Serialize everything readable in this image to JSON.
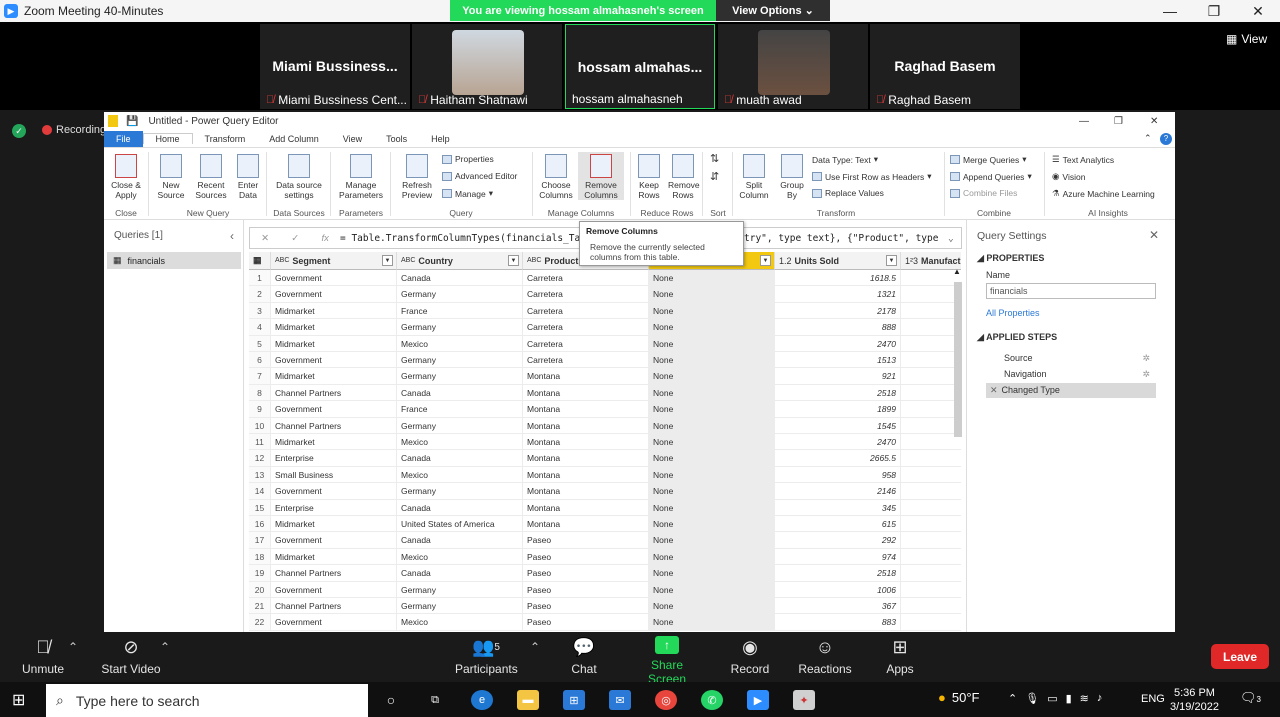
{
  "zoom": {
    "title": "Zoom Meeting 40-Minutes",
    "viewing_banner": "You are viewing hossam almahasneh's screen",
    "view_options": "View Options",
    "view_button": "View",
    "recording": "Recording",
    "participants": [
      {
        "big_name": "Miami  Bussiness...",
        "label": "Miami Bussiness Cent..."
      },
      {
        "big_name": "",
        "label": "Haitham Shatnawi"
      },
      {
        "big_name": "hossam  almahas...",
        "label": "hossam almahasneh"
      },
      {
        "big_name": "",
        "label": "muath awad"
      },
      {
        "big_name": "Raghad Basem",
        "label": "Raghad Basem"
      }
    ],
    "bottom": {
      "unmute": "Unmute",
      "start_video": "Start Video",
      "participants": "Participants",
      "participants_count": "5",
      "chat": "Chat",
      "share_screen": "Share Screen",
      "record": "Record",
      "reactions": "Reactions",
      "apps": "Apps",
      "leave": "Leave"
    }
  },
  "pq": {
    "title": "Untitled - Power Query Editor",
    "menu": [
      "File",
      "Home",
      "Transform",
      "Add Column",
      "View",
      "Tools",
      "Help"
    ],
    "ribbon": {
      "close_apply": "Close &\nApply",
      "new_source": "New\nSource",
      "recent_sources": "Recent\nSources",
      "enter_data": "Enter\nData",
      "data_source_settings": "Data source\nsettings",
      "manage_parameters": "Manage\nParameters",
      "refresh_preview": "Refresh\nPreview",
      "properties": "Properties",
      "advanced_editor": "Advanced Editor",
      "manage": "Manage",
      "choose_columns": "Choose\nColumns",
      "remove_columns": "Remove\nColumns",
      "keep_rows": "Keep\nRows",
      "remove_rows": "Remove\nRows",
      "split_column": "Split\nColumn",
      "group_by": "Group\nBy",
      "data_type": "Data Type: Text",
      "use_first_row": "Use First Row as Headers",
      "replace_values": "Replace Values",
      "merge_queries": "Merge Queries",
      "append_queries": "Append Queries",
      "combine_files": "Combine Files",
      "text_analytics": "Text Analytics",
      "vision": "Vision",
      "azure_ml": "Azure Machine Learning",
      "groups": [
        "Close",
        "New Query",
        "Data Sources",
        "Parameters",
        "Query",
        "Manage Columns",
        "Reduce Rows",
        "Sort",
        "Transform",
        "Combine",
        "AI Insights"
      ]
    },
    "queries_header": "Queries [1]",
    "query_item": "financials",
    "formula_left": "= Table.TransformColumnTypes(financials_Table",
    "formula_right": "try\", type text}, {\"Product\", type",
    "tooltip": {
      "title": "Remove Columns",
      "desc": "Remove the currently selected columns from this table."
    },
    "columns": [
      "Segment",
      "Country",
      "Product",
      "",
      "Units Sold",
      "Manufactur"
    ],
    "column_types": [
      "ABC",
      "ABC",
      "ABC",
      "",
      "1.2",
      "1²3"
    ],
    "rows": [
      [
        "1",
        "Government",
        "Canada",
        "Carretera",
        "None",
        "1618.5"
      ],
      [
        "2",
        "Government",
        "Germany",
        "Carretera",
        "None",
        "1321"
      ],
      [
        "3",
        "Midmarket",
        "France",
        "Carretera",
        "None",
        "2178"
      ],
      [
        "4",
        "Midmarket",
        "Germany",
        "Carretera",
        "None",
        "888"
      ],
      [
        "5",
        "Midmarket",
        "Mexico",
        "Carretera",
        "None",
        "2470"
      ],
      [
        "6",
        "Government",
        "Germany",
        "Carretera",
        "None",
        "1513"
      ],
      [
        "7",
        "Midmarket",
        "Germany",
        "Montana",
        "None",
        "921"
      ],
      [
        "8",
        "Channel Partners",
        "Canada",
        "Montana",
        "None",
        "2518"
      ],
      [
        "9",
        "Government",
        "France",
        "Montana",
        "None",
        "1899"
      ],
      [
        "10",
        "Channel Partners",
        "Germany",
        "Montana",
        "None",
        "1545"
      ],
      [
        "11",
        "Midmarket",
        "Mexico",
        "Montana",
        "None",
        "2470"
      ],
      [
        "12",
        "Enterprise",
        "Canada",
        "Montana",
        "None",
        "2665.5"
      ],
      [
        "13",
        "Small Business",
        "Mexico",
        "Montana",
        "None",
        "958"
      ],
      [
        "14",
        "Government",
        "Germany",
        "Montana",
        "None",
        "2146"
      ],
      [
        "15",
        "Enterprise",
        "Canada",
        "Montana",
        "None",
        "345"
      ],
      [
        "16",
        "Midmarket",
        "United States of America",
        "Montana",
        "None",
        "615"
      ],
      [
        "17",
        "Government",
        "Canada",
        "Paseo",
        "None",
        "292"
      ],
      [
        "18",
        "Midmarket",
        "Mexico",
        "Paseo",
        "None",
        "974"
      ],
      [
        "19",
        "Channel Partners",
        "Canada",
        "Paseo",
        "None",
        "2518"
      ],
      [
        "20",
        "Government",
        "Germany",
        "Paseo",
        "None",
        "1006"
      ],
      [
        "21",
        "Channel Partners",
        "Germany",
        "Paseo",
        "None",
        "367"
      ],
      [
        "22",
        "Government",
        "Mexico",
        "Paseo",
        "None",
        "883"
      ]
    ],
    "settings": {
      "header": "Query Settings",
      "properties": "PROPERTIES",
      "name_label": "Name",
      "name_value": "financials",
      "all_properties": "All Properties",
      "applied_steps": "APPLIED STEPS",
      "steps": [
        "Source",
        "Navigation",
        "Changed Type"
      ]
    }
  },
  "taskbar": {
    "search_placeholder": "Type here to search",
    "weather": "50°F",
    "lang": "ENG",
    "time": "5:36 PM",
    "date": "3/19/2022",
    "notifications": "3"
  }
}
